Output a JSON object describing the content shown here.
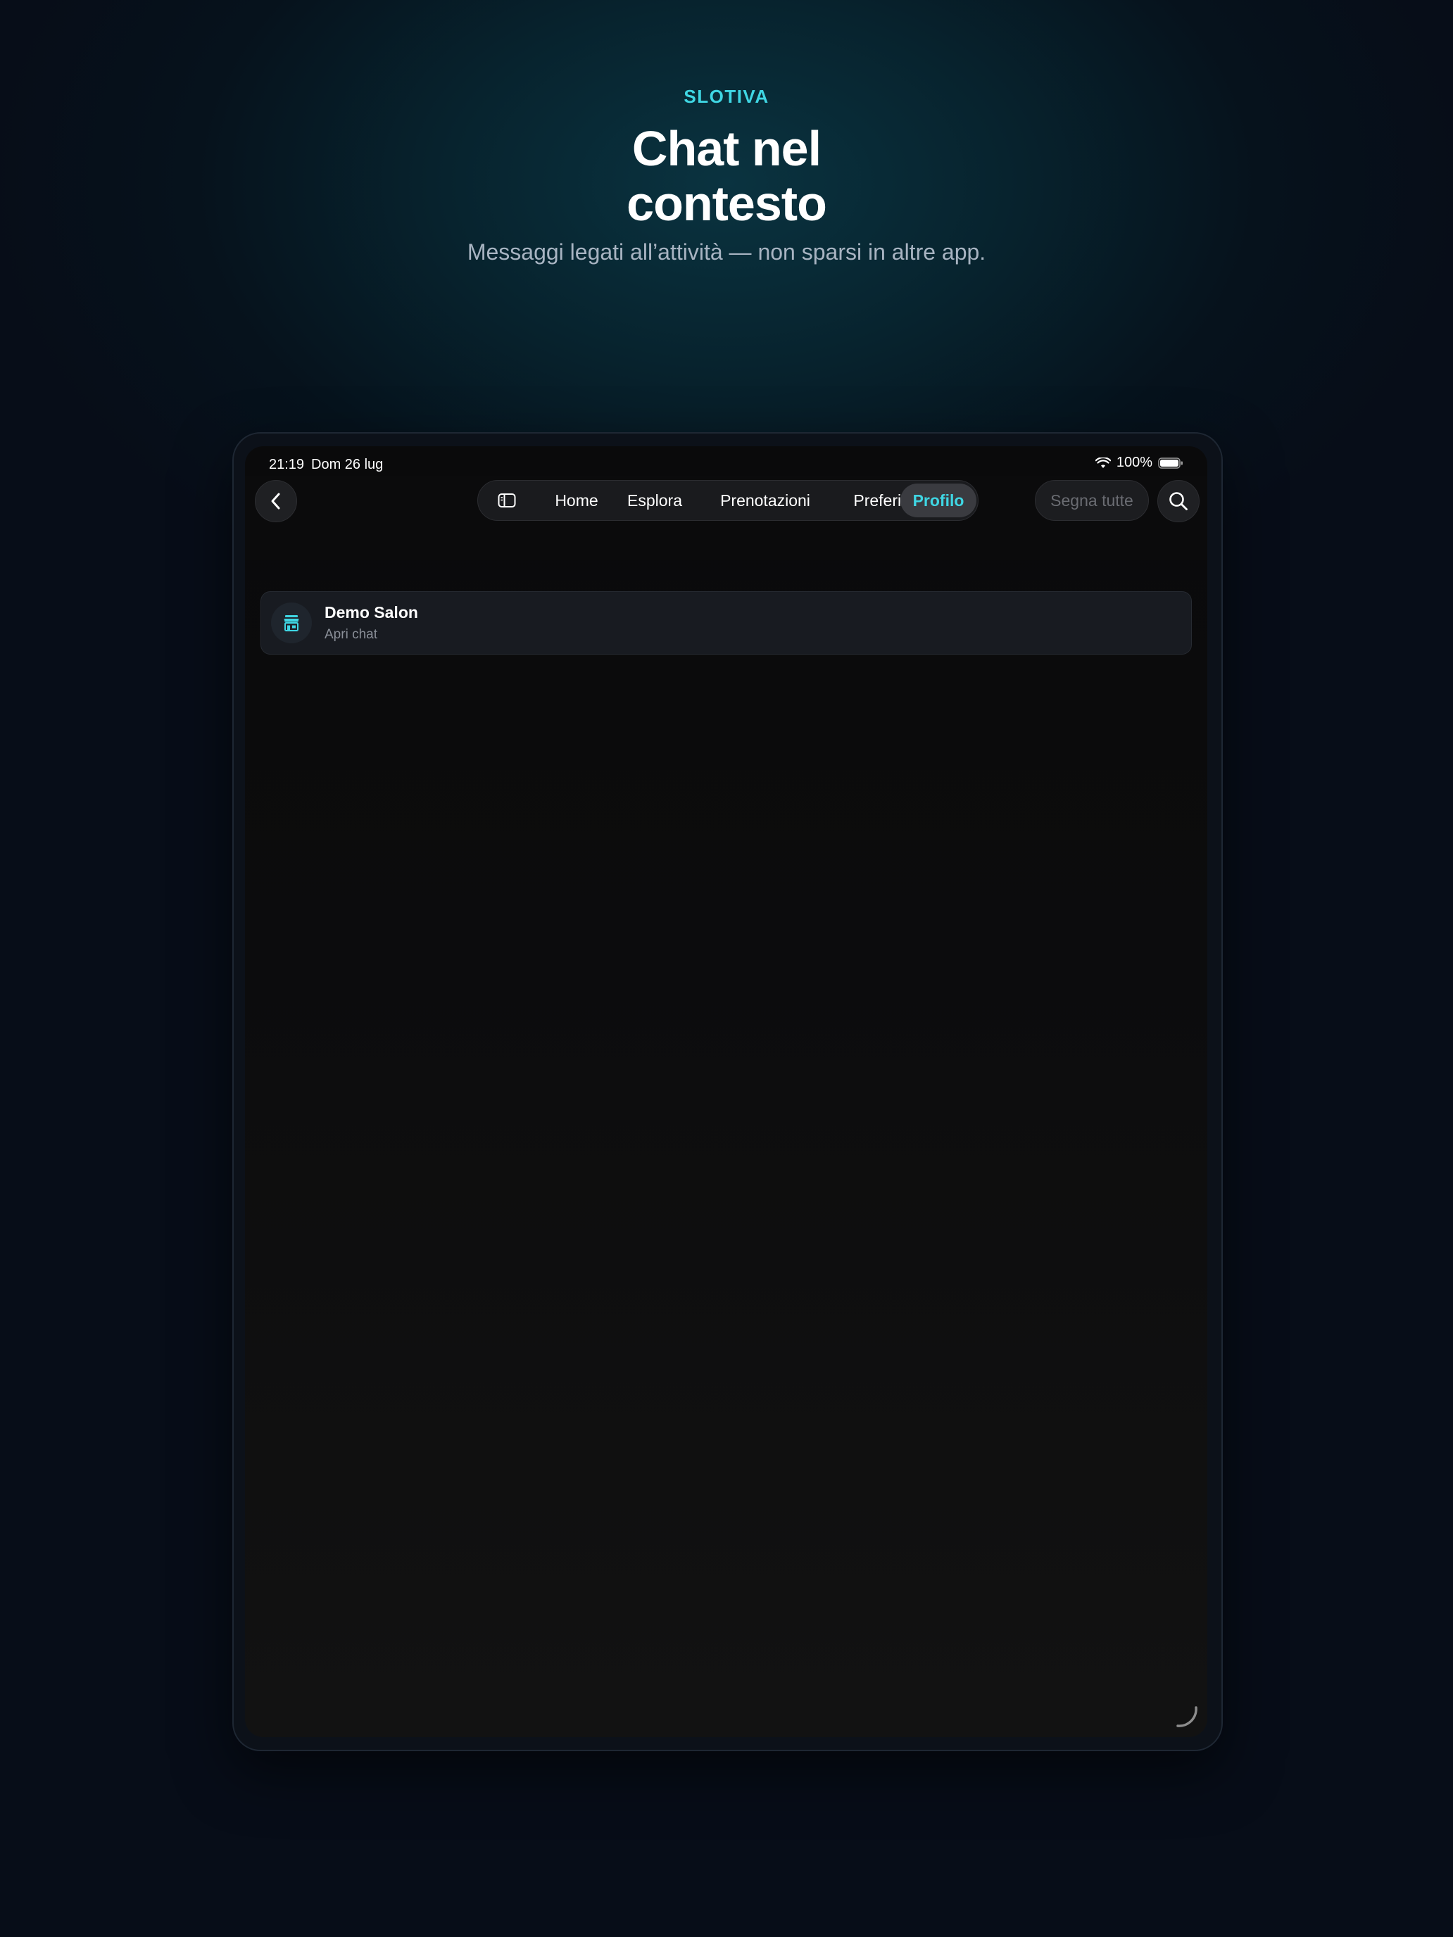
{
  "hero": {
    "eyebrow": "SLOTIVA",
    "headline_line1": "Chat nel",
    "headline_line2": "contesto",
    "subtitle": "Messaggi legati all’attività — non sparsi in altre app."
  },
  "status_bar": {
    "time": "21:19",
    "date": "Dom 26 lug",
    "battery": "100%",
    "icons": [
      "wifi-icon",
      "battery-icon"
    ]
  },
  "nav": {
    "back_icon": "chevron-left-icon",
    "sidebar_icon": "sidebar-toggle-icon",
    "tabs": [
      {
        "label": "Home",
        "active": false
      },
      {
        "label": "Esplora",
        "active": false
      },
      {
        "label": "Prenotazioni",
        "active": false
      },
      {
        "label": "Preferiti",
        "active": false
      },
      {
        "label": "Profilo",
        "active": true
      }
    ],
    "mark_all_label": "Segna tutte",
    "search_icon": "search-icon"
  },
  "chats": [
    {
      "name": "Demo Salon",
      "subtitle": "Apri chat",
      "icon": "storefront-icon"
    }
  ],
  "colors": {
    "accent": "#3fd6e3",
    "background": "#070d18",
    "screen": "#0c0c0d",
    "card": "#181b21"
  }
}
